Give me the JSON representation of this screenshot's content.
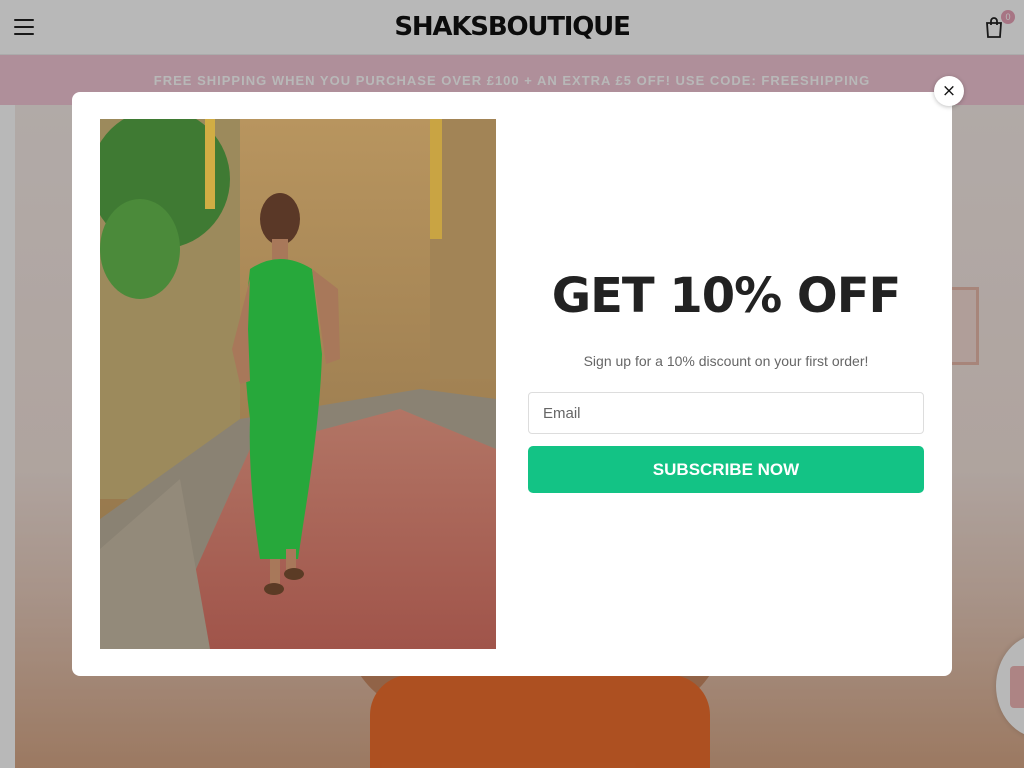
{
  "header": {
    "brand": "SHAKSBOUTIQUE",
    "cart_count": "0",
    "menu_icon": "hamburger-menu-icon",
    "cart_icon": "shopping-bag-icon"
  },
  "announcement": {
    "text": "FREE SHIPPING WHEN YOU PURCHASE OVER £100 + AN EXTRA £5 OFF! USE CODE: FREESHIPPING"
  },
  "popup": {
    "close_label": "×",
    "image_alt": "Model in green one-shoulder maxi dress on a stone street",
    "headline": "GET 10% OFF",
    "subheadline": "Sign up for a 10% discount on your first order!",
    "email_placeholder": "Email",
    "email_value": "",
    "subscribe_label": "SUBSCRIBE NOW"
  },
  "colors": {
    "announcement_bg": "#f3c6d6",
    "subscribe_bg": "#13c385",
    "cart_badge_bg": "#e8a3b8"
  }
}
